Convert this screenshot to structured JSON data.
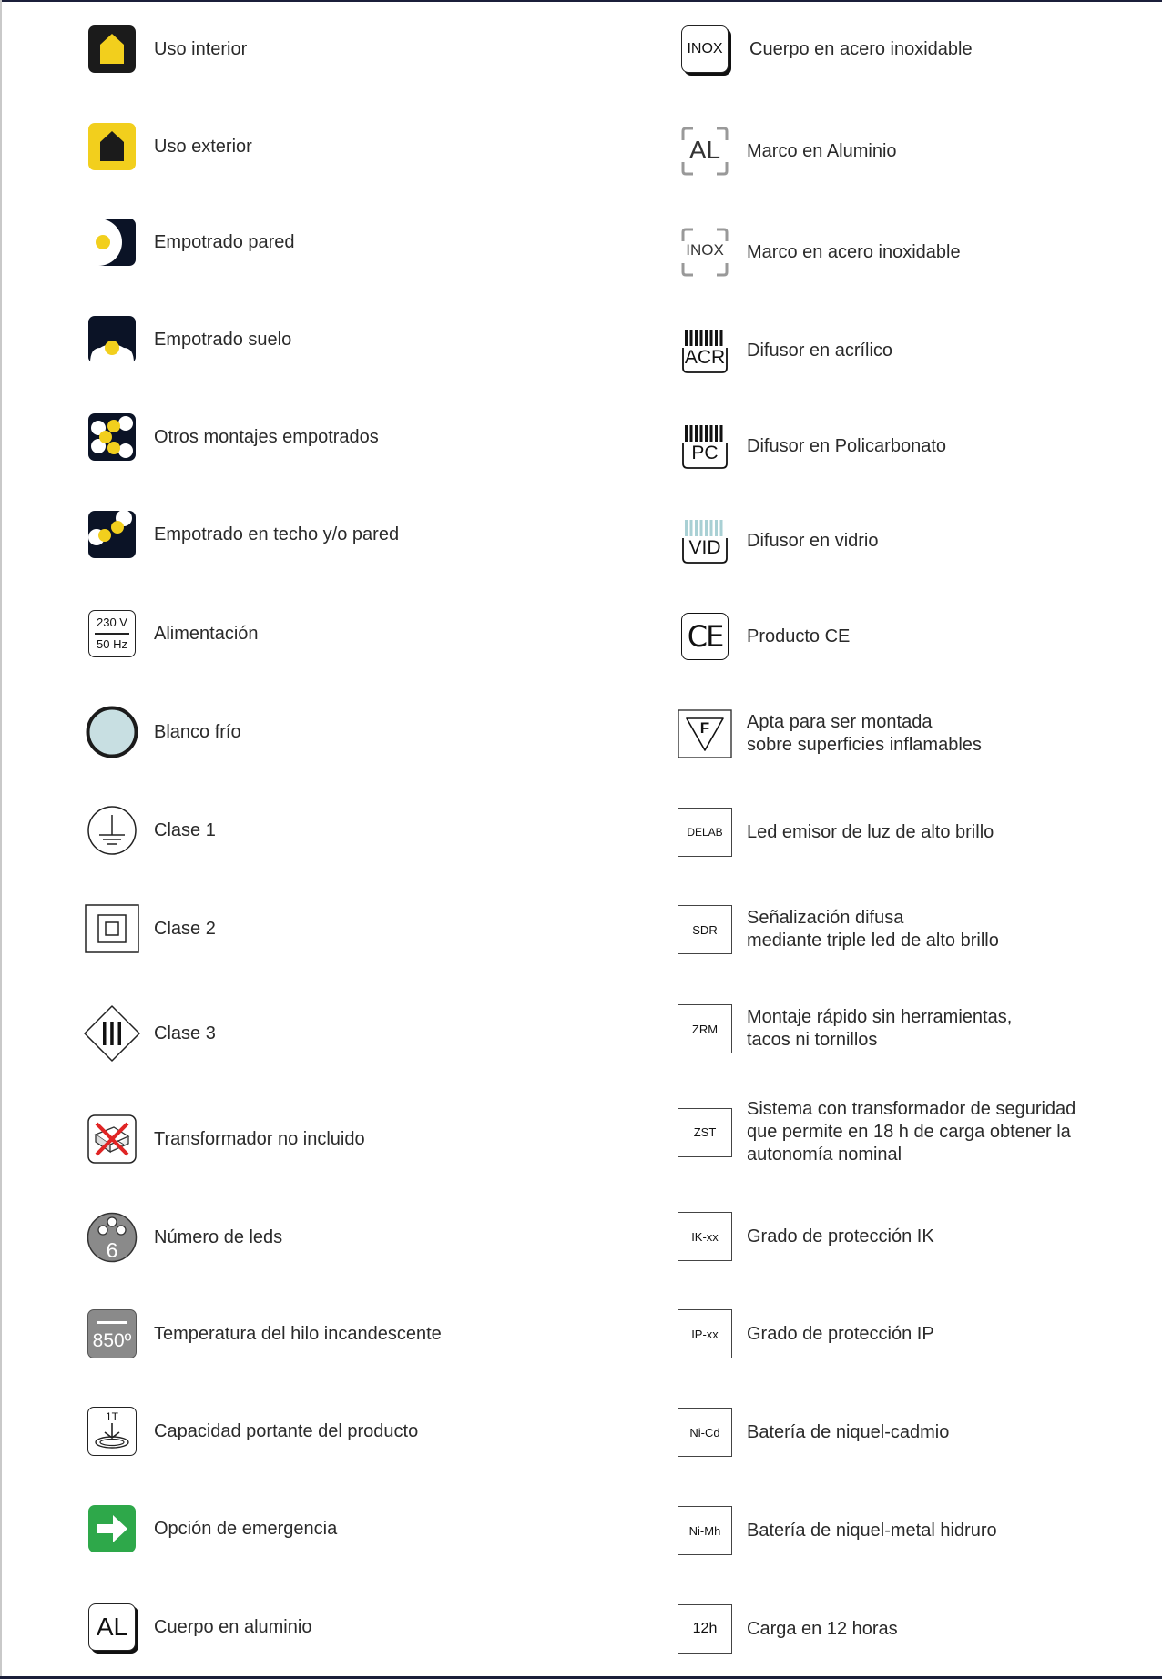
{
  "left_column": [
    {
      "icon": "home-icon",
      "label": "Uso interior"
    },
    {
      "icon": "home-outdoor-icon",
      "label": "Uso exterior"
    },
    {
      "icon": "wall-recessed-icon",
      "label": "Empotrado pared"
    },
    {
      "icon": "floor-recessed-icon",
      "label": "Empotrado suelo"
    },
    {
      "icon": "other-recessed-icon",
      "label": "Otros montajes empotrados"
    },
    {
      "icon": "ceiling-wall-recessed-icon",
      "label": "Empotrado en techo y/o pared"
    },
    {
      "icon": "power-supply-icon",
      "label": "Alimentación",
      "icon_text": [
        "230 V",
        "50 Hz"
      ]
    },
    {
      "icon": "cold-white-icon",
      "label": "Blanco frío"
    },
    {
      "icon": "class1-earth-icon",
      "label": "Clase 1"
    },
    {
      "icon": "class2-double-square-icon",
      "label": "Clase 2"
    },
    {
      "icon": "class3-diamond-icon",
      "label": "Clase 3"
    },
    {
      "icon": "no-transformer-icon",
      "label": "Transformador no incluido"
    },
    {
      "icon": "led-count-icon",
      "label": "Número de leds",
      "icon_text": "6"
    },
    {
      "icon": "glow-wire-icon",
      "label": "Temperatura del hilo incandescente",
      "icon_text": "850º"
    },
    {
      "icon": "load-capacity-icon",
      "label": "Capacidad portante del producto",
      "icon_text": "1T"
    },
    {
      "icon": "emergency-arrow-icon",
      "label": "Opción de emergencia"
    },
    {
      "icon": "aluminium-body-icon",
      "label": "Cuerpo en aluminio",
      "icon_text": "AL"
    }
  ],
  "right_column": [
    {
      "icon": "inox-body-icon",
      "label": "Cuerpo en acero inoxidable",
      "icon_text": "INOX"
    },
    {
      "icon": "aluminium-frame-icon",
      "label": "Marco en Aluminio",
      "icon_text": "AL"
    },
    {
      "icon": "inox-frame-icon",
      "label": "Marco en acero inoxidable",
      "icon_text": "INOX"
    },
    {
      "icon": "acrylic-diffuser-icon",
      "label": "Difusor en acrílico",
      "icon_text": "ACR"
    },
    {
      "icon": "polycarbonate-diffuser-icon",
      "label": "Difusor en Policarbonato",
      "icon_text": "PC"
    },
    {
      "icon": "glass-diffuser-icon",
      "label": "Difusor en vidrio",
      "icon_text": "VID"
    },
    {
      "icon": "ce-mark-icon",
      "label": "Producto CE",
      "icon_text": "CE"
    },
    {
      "icon": "flammable-surface-icon",
      "label": [
        "Apta para ser montada",
        "sobre superficies inflamables"
      ],
      "icon_text": "F"
    },
    {
      "icon": "delab-icon",
      "label": "Led emisor de luz de alto brillo",
      "icon_text": "DELAB"
    },
    {
      "icon": "sdr-icon",
      "label": [
        "Señalización difusa",
        "mediante triple led de alto brillo"
      ],
      "icon_text": "SDR"
    },
    {
      "icon": "zrm-icon",
      "label": [
        "Montaje rápido sin herramientas,",
        "tacos ni tornillos"
      ],
      "icon_text": "ZRM"
    },
    {
      "icon": "zst-icon",
      "label": [
        "Sistema con transformador de seguridad",
        "que permite en 18 h de carga obtener la",
        "autonomía nominal"
      ],
      "icon_text": "ZST"
    },
    {
      "icon": "ik-rating-icon",
      "label": "Grado de protección IK",
      "icon_text": "IK-xx"
    },
    {
      "icon": "ip-rating-icon",
      "label": "Grado de protección IP",
      "icon_text": "IP-xx"
    },
    {
      "icon": "nicd-battery-icon",
      "label": "Batería de niquel-cadmio",
      "icon_text": "Ni-Cd"
    },
    {
      "icon": "nimh-battery-icon",
      "label": "Batería de niquel-metal hidruro",
      "icon_text": "Ni-Mh"
    },
    {
      "icon": "charge-12h-icon",
      "label": "Carga en 12 horas",
      "icon_text": "12h"
    }
  ],
  "colors": {
    "yellow": "#f2cf1d",
    "dark": "#1b1b1b",
    "navy": "#0b1326",
    "cold_white": "#c8dfe2",
    "green": "#2ea84a",
    "grey": "#8a8a8a"
  }
}
